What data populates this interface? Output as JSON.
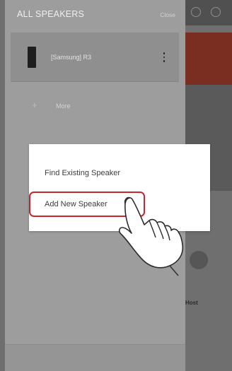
{
  "panel": {
    "title": "ALL SPEAKERS",
    "close_label": "Close",
    "speakers": [
      {
        "name": "[Samsung] R3"
      }
    ],
    "more_label": "More"
  },
  "popup": {
    "items": [
      {
        "label": "Find Existing Speaker"
      },
      {
        "label": "Add New Speaker",
        "highlighted": true
      }
    ]
  },
  "background_app": {
    "partial_text": "Host"
  },
  "colors": {
    "highlight": "#c8252d",
    "overlay_panel": "#9d9d9d",
    "popup_bg": "#ffffff"
  },
  "icons": [
    "speaker-device-icon",
    "kebab-menu-icon",
    "plus-icon",
    "hand-pointer-icon"
  ]
}
